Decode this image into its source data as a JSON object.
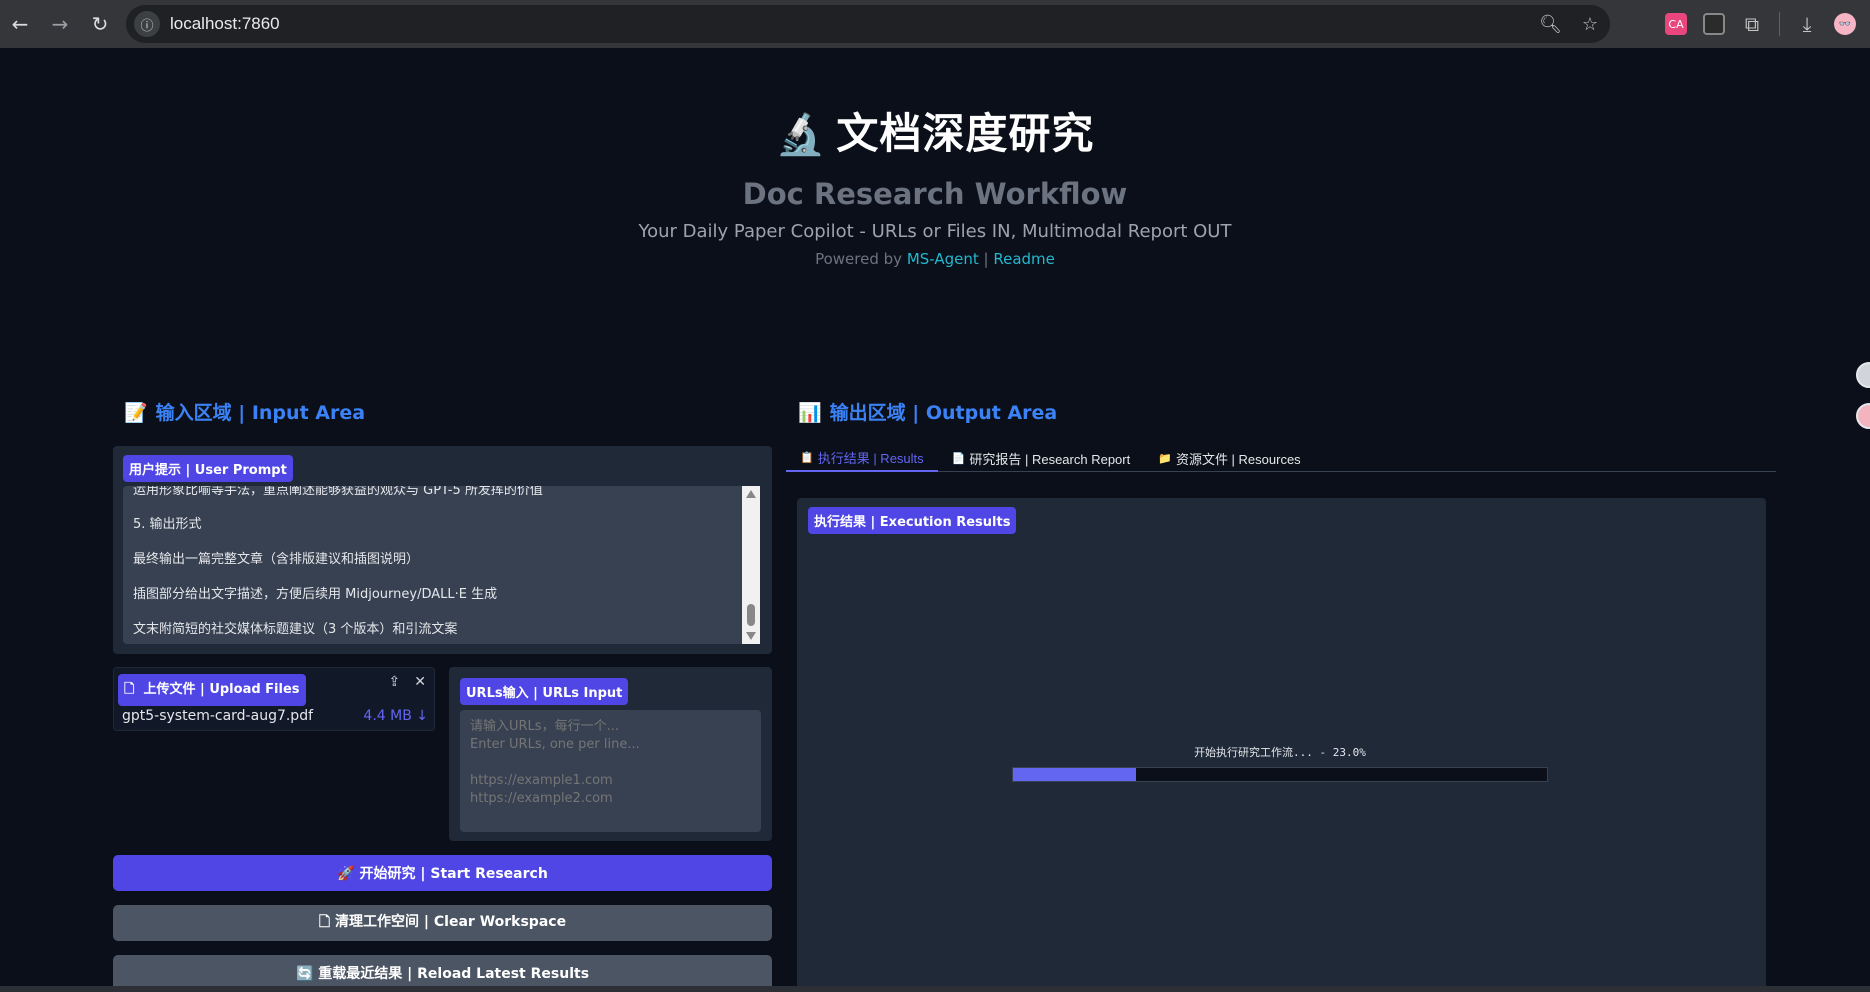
{
  "browser": {
    "url": "localhost:7860",
    "ext_translate": "CA",
    "avatar": "👓"
  },
  "hero": {
    "emoji": "🔬",
    "title": "文档深度研究",
    "subtitle": "Doc Research Workflow",
    "tagline": "Your Daily Paper Copilot - URLs or Files IN, Multimodal Report OUT",
    "powered_prefix": "Powered by ",
    "powered_link": "MS-Agent",
    "powered_sep": " | ",
    "readme_link": "Readme"
  },
  "input_area": {
    "emoji": "📝",
    "heading": "输入区域 | Input Area",
    "prompt_label": "用户提示 | User Prompt",
    "prompt_lines": [
      "运用形象比喻等手法，重点阐述能够获益的观众与 GPT-5 所发挥的价值",
      "5. 输出形式",
      "最终输出一篇完整文章（含排版建议和插图说明）",
      "插图部分给出文字描述，方便后续用 Midjourney/DALL·E 生成",
      "文末附简短的社交媒体标题建议（3 个版本）和引流文案"
    ],
    "upload_label": "上传文件 | Upload Files",
    "upload_icon": "🗋",
    "file_name": "gpt5-system-card-aug7.pdf",
    "file_size": "4.4 MB ↓",
    "urls_label": "URLs输入 | URLs Input",
    "urls_placeholder": "请输入URLs，每行一个...\nEnter URLs, one per line...\n\nhttps://example1.com\nhttps://example2.com"
  },
  "buttons": {
    "start": "🚀 开始研究 | Start Research",
    "clear": "🗋 清理工作空间 | Clear Workspace",
    "reload": "🔄 重载最近结果 | Reload Latest Results"
  },
  "output_area": {
    "emoji": "📊",
    "heading": "输出区域 | Output Area",
    "tabs": [
      {
        "emoji": "📋",
        "label": "执行结果 | Results"
      },
      {
        "emoji": "📄",
        "label": "研究报告 | Research Report"
      },
      {
        "emoji": "📁",
        "label": "资源文件 | Resources"
      }
    ],
    "results_label": "执行结果 | Execution Results",
    "progress_text": "开始执行研究工作流... - 23.0%",
    "progress_value": 0.23
  },
  "colors": {
    "accent": "#4f46e5",
    "heading": "#3b82f6",
    "link": "#22b8cf"
  }
}
